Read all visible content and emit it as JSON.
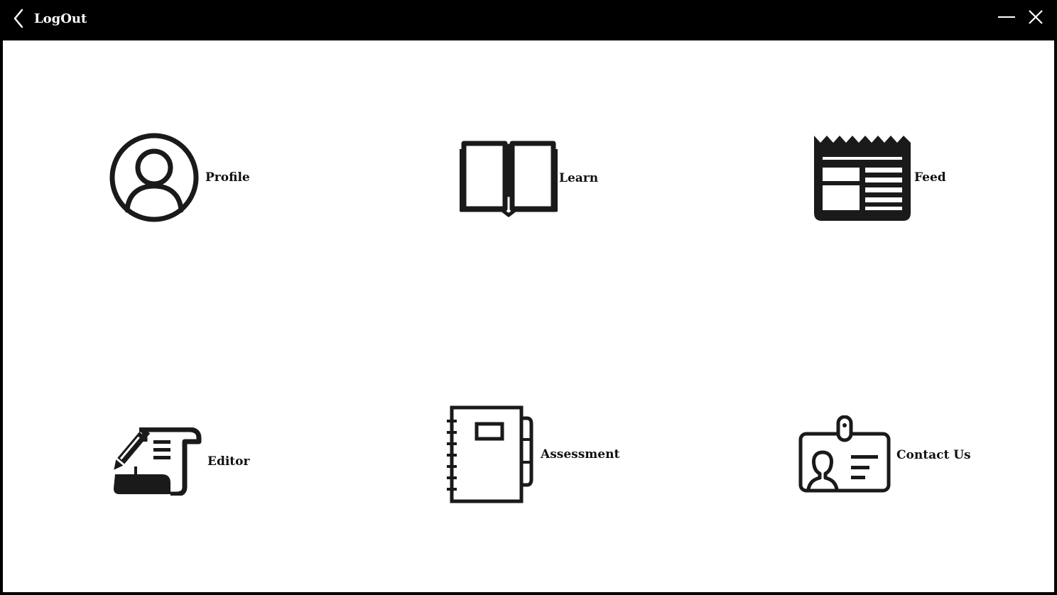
{
  "titlebar": {
    "back_label": "LogOut",
    "back_icon": "chevron-left-icon",
    "minimize_icon": "minimize-icon",
    "close_icon": "close-icon"
  },
  "menu": {
    "items": [
      {
        "label": "Profile",
        "icon": "user-circle-icon"
      },
      {
        "label": "Learn",
        "icon": "open-book-icon"
      },
      {
        "label": "Feed",
        "icon": "newspaper-icon"
      },
      {
        "label": "Editor",
        "icon": "pen-scroll-icon"
      },
      {
        "label": "Assessment",
        "icon": "notebook-icon"
      },
      {
        "label": "Contact Us",
        "icon": "id-badge-icon"
      }
    ]
  },
  "colors": {
    "frame": "#000000",
    "background": "#ffffff",
    "icon": "#1a1a1a",
    "text": "#111111"
  }
}
